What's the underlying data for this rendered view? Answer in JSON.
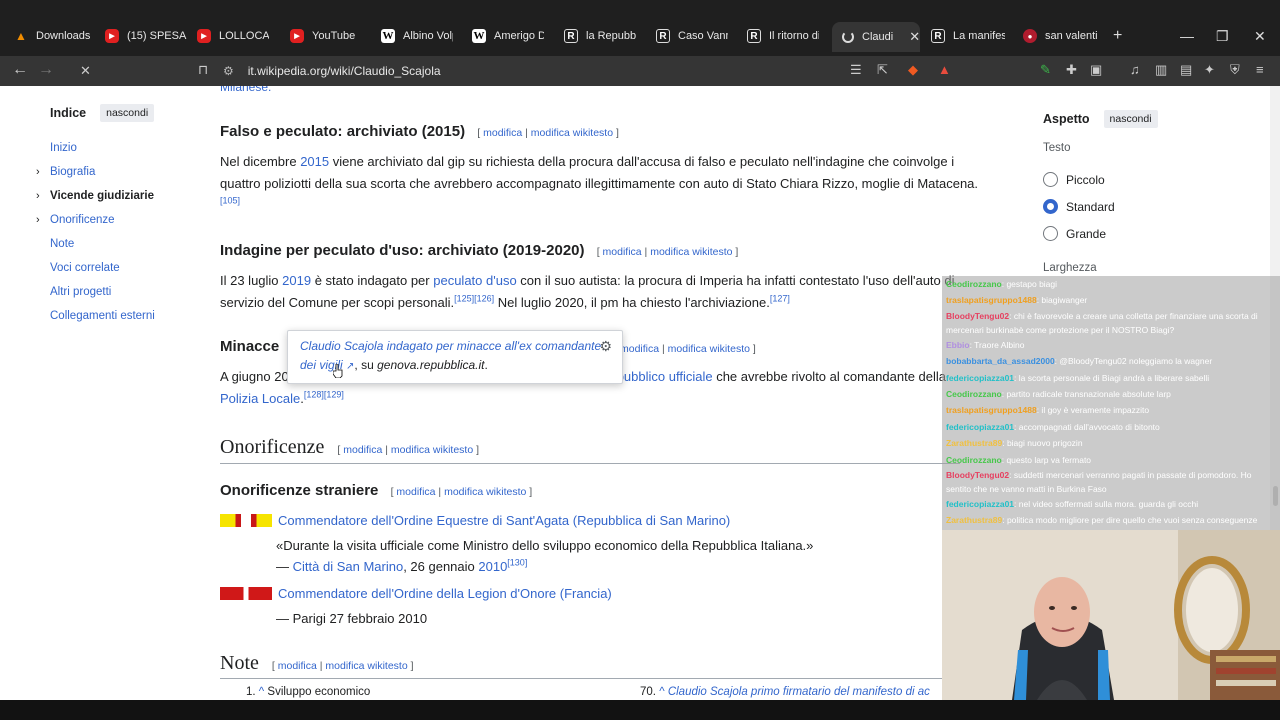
{
  "browser": {
    "tabs": [
      {
        "label": "Downloads",
        "icon": "vlc-icon"
      },
      {
        "label": "(15) SPESA",
        "icon": "youtube-icon"
      },
      {
        "label": "LOLLOCAUS",
        "icon": "youtube-icon"
      },
      {
        "label": "YouTube",
        "icon": "youtube-icon"
      },
      {
        "label": "Albino Volp",
        "icon": "wikipedia-icon"
      },
      {
        "label": "Amerigo De",
        "icon": "wikipedia-icon"
      },
      {
        "label": "la Repubbli",
        "icon": "repubblica-icon"
      },
      {
        "label": "Caso Vanna",
        "icon": "repubblica-icon"
      },
      {
        "label": "Il ritorno di",
        "icon": "repubblica-icon"
      },
      {
        "label": "Claudi",
        "icon": "loading-icon"
      },
      {
        "label": "La manifest",
        "icon": "repubblica-icon"
      },
      {
        "label": "san valenti",
        "icon": "site-icon"
      }
    ],
    "new_tab": "+",
    "url": "it.wikipedia.org/wiki/Claudio_Scajola"
  },
  "toc": {
    "title": "Indice",
    "hide": "nascondi",
    "items": [
      "Inizio",
      "Biografia",
      "Vicende giudiziarie",
      "Onorificenze",
      "Note",
      "Voci correlate",
      "Altri progetti",
      "Collegamenti esterni"
    ]
  },
  "article": {
    "fragment": "Milanese.",
    "edit": "modifica",
    "edit_source": "modifica wikitesto",
    "sections": {
      "falso_title": "Falso e peculato: archiviato (2015)",
      "falso_text_1": "Nel dicembre ",
      "falso_link_year": "2015",
      "falso_text_2": " viene archiviato dal gip su richiesta della procura dall'accusa di falso e peculato nell'indagine che coinvolge i quattro poliziotti della sua scorta che avrebbero accompagnato illegittimamente con auto di Stato Chiara Rizzo, moglie di Matacena.",
      "falso_ref": "[105]",
      "peculato_title": "Indagine per peculato d'uso: archiviato (2019-2020)",
      "peculato_text_1": "Il 23 luglio ",
      "peculato_link_year": "2019",
      "peculato_text_2": " è stato indagato per ",
      "peculato_link": "peculato d'uso",
      "peculato_text_3": " con il suo autista: la procura di Imperia ha infatti contestato l'uso dell'auto di servizio del Comune per scopi personali.",
      "peculato_ref_1": "[125][126]",
      "peculato_text_4": " Nel luglio 2020, il pm ha chiesto l'archiviazione.",
      "peculato_ref_2": "[127]",
      "minacce_title": "Minacce",
      "minacce_text_1": "A giugno 20",
      "minacce_link": "pubblico ufficiale",
      "minacce_text_2": " che avrebbe rivolto al comandante della",
      "minacce_link_2": "Polizia Locale",
      "minacce_text_3": ".",
      "minacce_ref": "[128][129]",
      "onorificenze_title": "Onorificenze",
      "straniere_title": "Onorificenze straniere",
      "hon1": "Commendatore dell'Ordine Equestre di Sant'Agata (Repubblica di San Marino)",
      "hon1_quote": "«Durante la visita ufficiale come Ministro dello sviluppo economico della Repubblica Italiana.»",
      "hon1_source_dash": "— ",
      "hon1_source_link": "Città di San Marino",
      "hon1_source_date": ", 26 gennaio ",
      "hon1_source_year": "2010",
      "hon1_ref": "[130]",
      "hon2": "Commendatore dell'Ordine della Legion d'Onore (Francia)",
      "hon2_source": "— Parigi 27 febbraio 2010",
      "note_title": "Note",
      "note_1_num": "1.",
      "note_1_caret": "^",
      "note_1_text": "Sviluppo economico",
      "note_70_num": "70.",
      "note_70_caret": "^",
      "note_70_text": "Claudio Scajola primo firmatario del manifesto di ac"
    }
  },
  "popup": {
    "link": "Claudio Scajola indagato per minacce all'ex comandante dei vigili",
    "ext_mark": "↗",
    "tail_1": ", su ",
    "source": "genova.repubblica.it",
    "tail_2": "."
  },
  "aspect": {
    "title": "Aspetto",
    "hide": "nascondi",
    "text_label": "Testo",
    "options": [
      "Piccolo",
      "Standard",
      "Grande"
    ],
    "selected": "Standard",
    "width_label": "Larghezza"
  },
  "chat": [
    {
      "user": "Ceodirozzano",
      "text": "gestapo biagi",
      "color": "#46c84a"
    },
    {
      "user": "traslapatisgruppo1488",
      "text": "biagiwanger",
      "color": "#f0a020"
    },
    {
      "user": "BloodyTengu02",
      "text": "chi è favorevole a creare una colletta per finanziare una scorta di mercenari burkinabè come protezione per il NOSTRO Biagi?",
      "color": "#e64060"
    },
    {
      "user": "Ebbio",
      "text": "Traore Albino",
      "color": "#b08fe0"
    },
    {
      "user": "bobabbarta_da_assad2000",
      "text": "@BloodyTengu02 noleggiamo la wagner",
      "color": "#3a90e0"
    },
    {
      "user": "federicopiazza01",
      "text": "la scorta personale di Biagi andrà a liberare sabelli",
      "color": "#22c0c8"
    },
    {
      "user": "Ceodirozzano",
      "text": "partito radicale transnazionale absolute larp",
      "color": "#46c84a"
    },
    {
      "user": "traslapatisgruppo1488",
      "text": "il goy è veramente impazzito",
      "color": "#f0a020"
    },
    {
      "user": "federicopiazza01",
      "text": "accompagnati dall'avvocato di bitonto",
      "color": "#22c0c8"
    },
    {
      "user": "Zarathustra89",
      "text": "biagi nuovo prigozin",
      "color": "#f0c040"
    },
    {
      "user": "Ceodirozzano",
      "text": "questo larp va fermato",
      "color": "#46c84a"
    },
    {
      "user": "BloodyTengu02",
      "text": "suddetti mercenari verranno pagati in passate di pomodoro. Ho sentito che ne vanno matti in Burkina Faso",
      "color": "#e64060"
    },
    {
      "user": "federicopiazza01",
      "text": "nel video soffermati sulla mora. guarda gli occhi",
      "color": "#22c0c8"
    },
    {
      "user": "Zarathustra89",
      "text": "politica modo migliore per dire quello che vuoi senza conseguenze",
      "color": "#f0c040"
    }
  ]
}
